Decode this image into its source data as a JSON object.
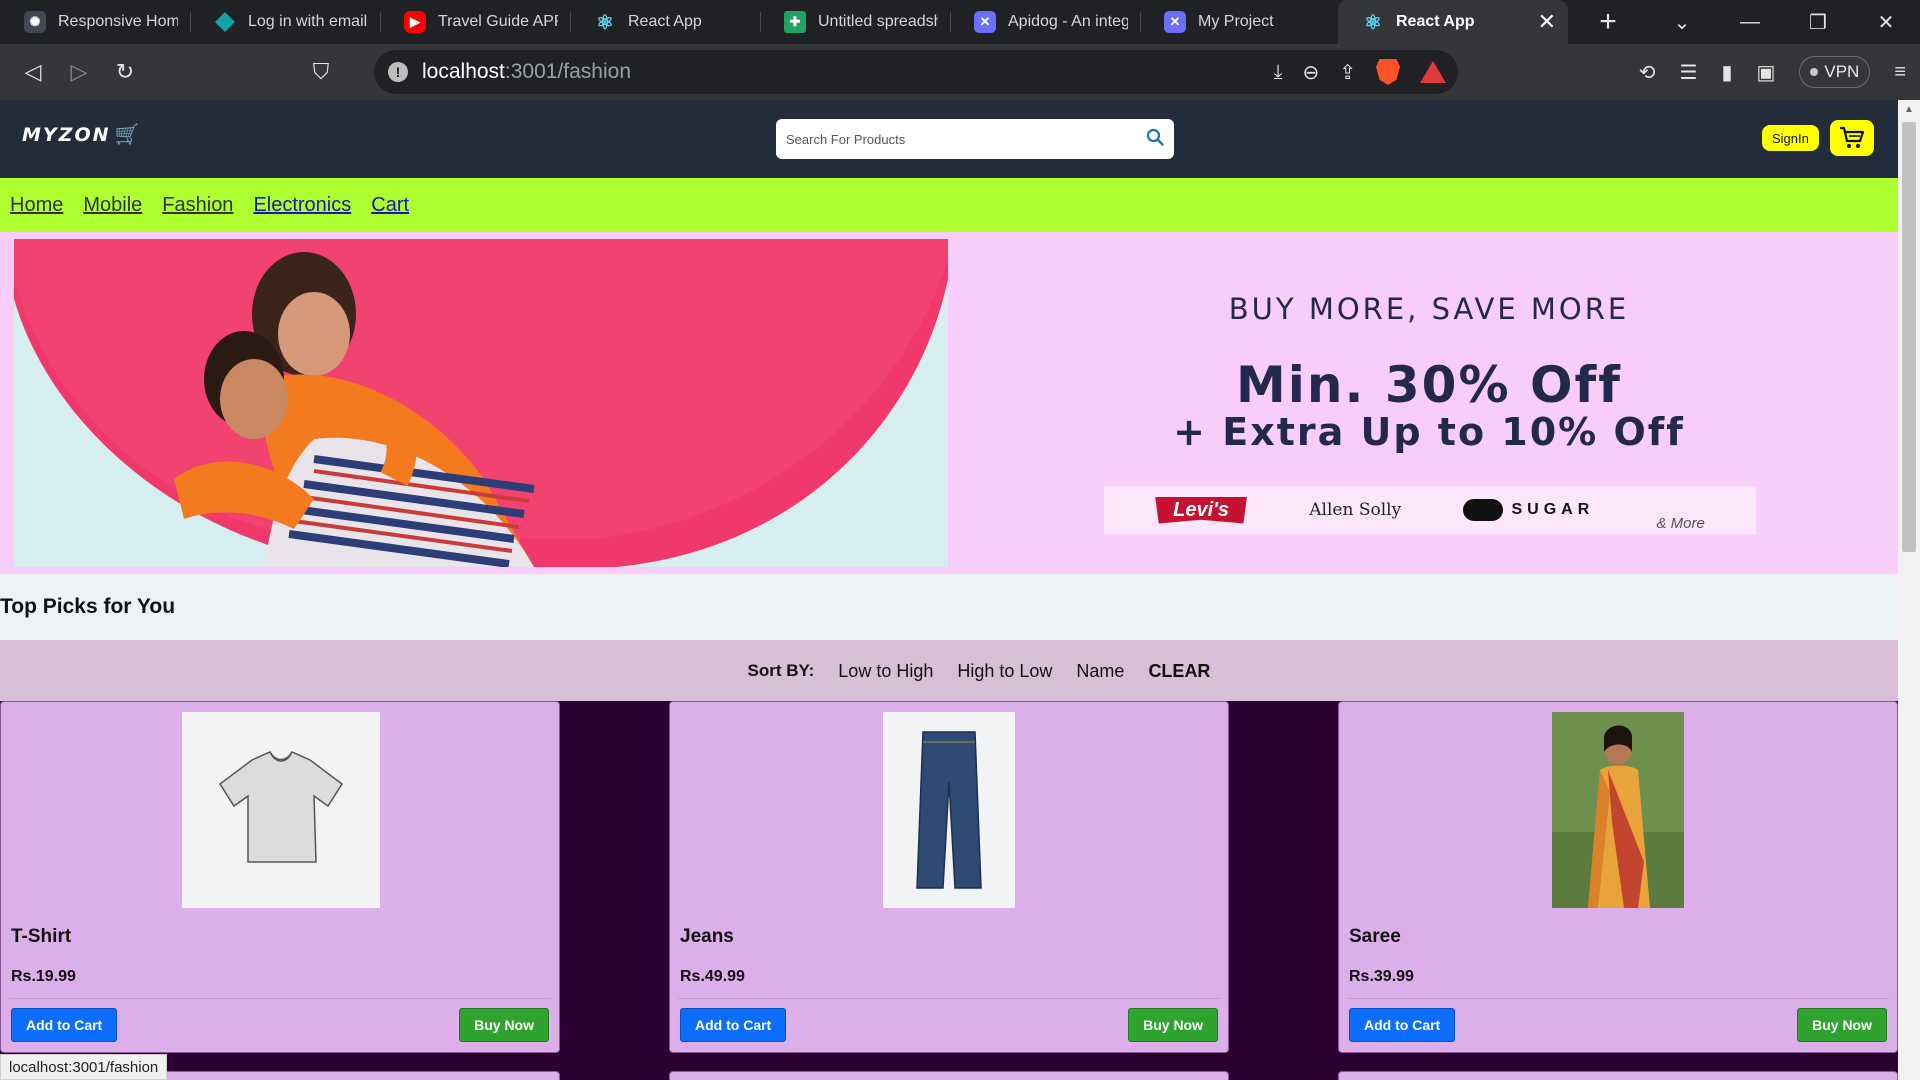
{
  "browser": {
    "tabs": [
      {
        "title": "Responsive Home D",
        "favicon": "chatgpt-icon",
        "color": "#444654"
      },
      {
        "title": "Log in with email | N",
        "favicon": "diamond-icon",
        "color": "#0fa3a3"
      },
      {
        "title": "Travel Guide APP DE",
        "favicon": "youtube-icon",
        "color": "#ff0000"
      },
      {
        "title": "React App",
        "favicon": "react-icon",
        "color": "#61dafb"
      },
      {
        "title": "Untitled spreadshee",
        "favicon": "sheets-icon",
        "color": "#1fa463"
      },
      {
        "title": "Apidog - An integra",
        "favicon": "apidog-icon",
        "color": "#6b6ef9"
      },
      {
        "title": "My Project",
        "favicon": "apidog-icon",
        "color": "#6b6ef9"
      }
    ],
    "active_tab": {
      "title": "React App",
      "favicon": "react-icon"
    },
    "url_host": "localhost",
    "url_path": ":3001/fashion",
    "vpn_label": "VPN"
  },
  "site": {
    "logo_text": "MYZON",
    "search_placeholder": "Search For Products",
    "signin_label": "SignIn",
    "nav": [
      "Home",
      "Mobile",
      "Fashion",
      "Electronics",
      "Cart"
    ]
  },
  "banner": {
    "line1": "BUY MORE, SAVE MORE",
    "line2": "Min. 30% Off",
    "line3": "+ Extra Up to 10% Off",
    "brands": [
      "Levi's",
      "Allen Solly",
      "SUGAR",
      "& More"
    ]
  },
  "section_title": "Top Picks for You",
  "sort": {
    "label": "Sort BY:",
    "options": [
      "Low to High",
      "High to Low",
      "Name"
    ],
    "clear": "CLEAR"
  },
  "products": [
    {
      "name": "T-Shirt",
      "price": "Rs.19.99",
      "add_label": "Add to Cart",
      "buy_label": "Buy Now"
    },
    {
      "name": "Jeans",
      "price": "Rs.49.99",
      "add_label": "Add to Cart",
      "buy_label": "Buy Now"
    },
    {
      "name": "Saree",
      "price": "Rs.39.99",
      "add_label": "Add to Cart",
      "buy_label": "Buy Now"
    }
  ],
  "status_url": "localhost:3001/fashion",
  "colors": {
    "header_bg": "#222c3b",
    "nav_bg": "#adff2f",
    "banner_bg": "#f9cdf9",
    "sort_bg": "#d8bfd8",
    "card_bg": "#dcaeea",
    "grid_bg": "#2c0033",
    "add_btn": "#0d6efd",
    "buy_btn": "#2ea42e",
    "signin_bg": "#ffff00"
  }
}
